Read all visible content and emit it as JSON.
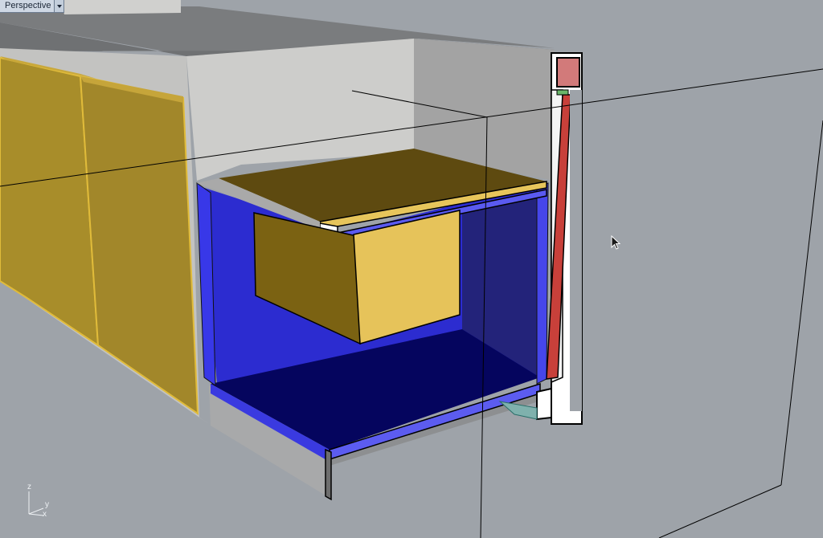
{
  "viewport": {
    "title": "Perspective",
    "background_color": "#9ea3a9"
  },
  "axis": {
    "z_label": "z",
    "y_label": "y",
    "x_label": "x"
  },
  "colors": {
    "cabinet_gray": "#c6c6c4",
    "door_yellow": "#a88d2a",
    "drawer_blue": "#1c1ccc",
    "drawer_floor_blue": "#05055e",
    "lid_brown": "#6a5412",
    "box_yellow": "#e6c35a",
    "rail_red": "#c8403a",
    "slide_red_cap": "#d27a7a"
  },
  "icons": {
    "viewport_menu": "chevron-down-icon",
    "cursor": "arrow-cursor-icon"
  }
}
